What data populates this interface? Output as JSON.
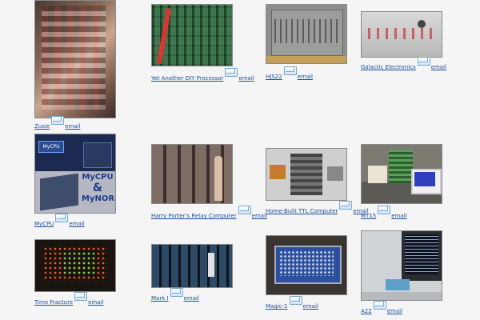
{
  "gallery": {
    "email_label": "email",
    "items": [
      {
        "title": "Zusie"
      },
      {
        "title": "Yet Another DIY Processor"
      },
      {
        "title": "HJS22"
      },
      {
        "title": "Galactic Electronics"
      },
      {
        "title": "MyCPU"
      },
      {
        "title": "Harry Porter's Relay Computer"
      },
      {
        "title": "Home-Built TTL Computer"
      },
      {
        "title": "MT15"
      },
      {
        "title": "Time Fracture"
      },
      {
        "title": "Mark I"
      },
      {
        "title": "Magic-1"
      },
      {
        "title": "A22"
      }
    ],
    "mycpu_text": {
      "line1": "MyCPU",
      "amp": "&",
      "line2": "MyNOR",
      "badge": "MyCPU"
    }
  }
}
